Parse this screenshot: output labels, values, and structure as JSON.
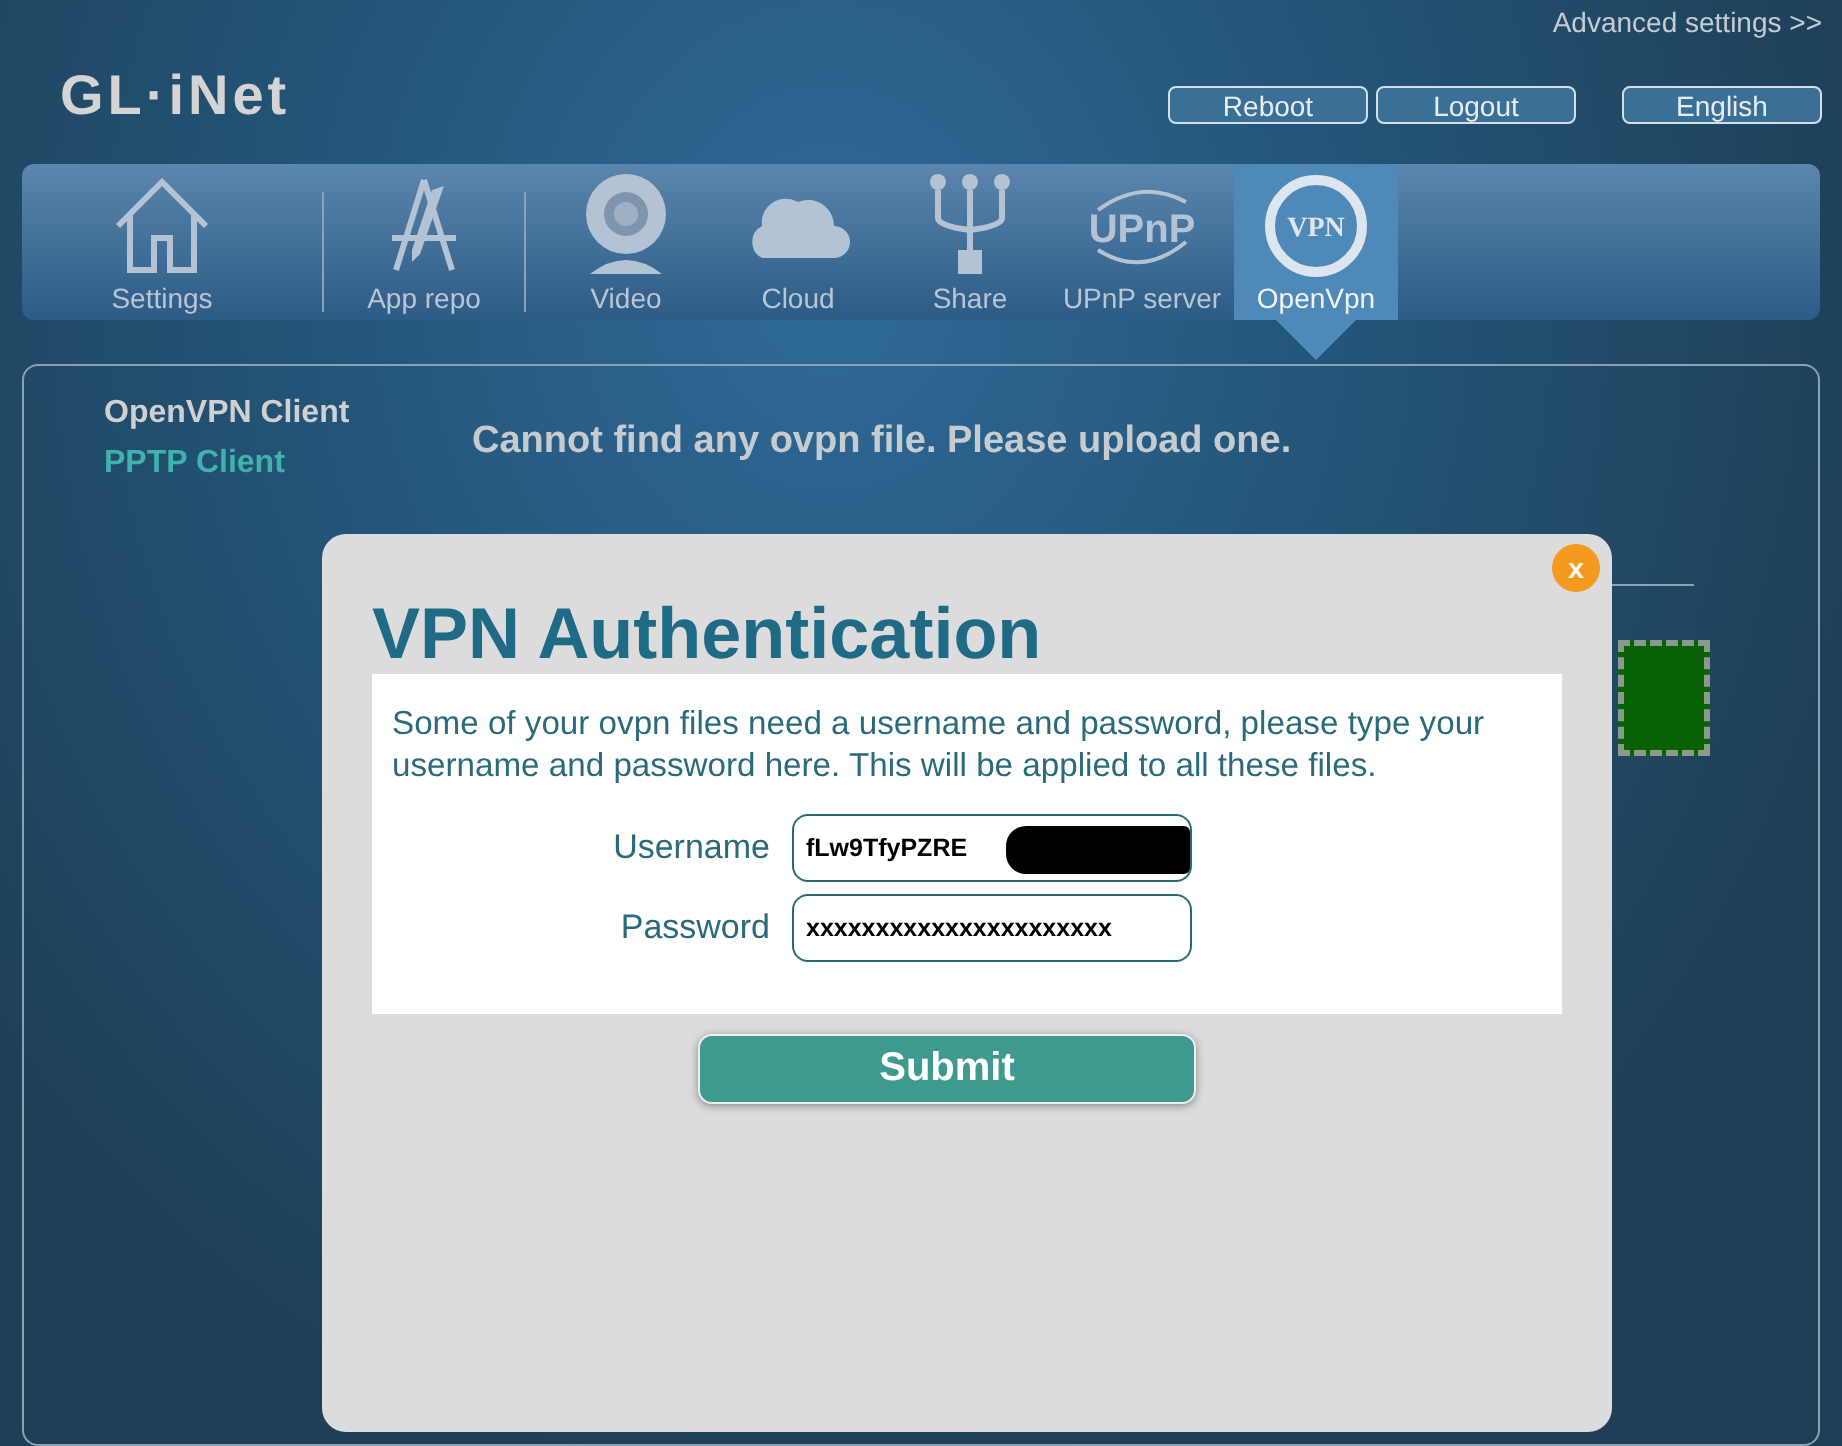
{
  "header": {
    "logo": "GL·iNet",
    "advanced_link": "Advanced settings >>",
    "buttons": [
      {
        "label": "Reboot"
      },
      {
        "label": "Logout"
      },
      {
        "label": "English"
      }
    ]
  },
  "nav": {
    "tabs": [
      {
        "label": "Settings",
        "kind": "home",
        "selected": false,
        "separator_after": true
      },
      {
        "label": "App repo",
        "kind": "apps",
        "selected": false,
        "separator_after": true
      },
      {
        "label": "Video",
        "kind": "camera",
        "selected": false,
        "separator_after": false
      },
      {
        "label": "Cloud",
        "kind": "cloud",
        "selected": false,
        "separator_after": false
      },
      {
        "label": "Share",
        "kind": "usb",
        "selected": false,
        "separator_after": false
      },
      {
        "label": "UPnP server",
        "kind": "upnp",
        "icon_text": "UPnP",
        "selected": false,
        "separator_after": false
      },
      {
        "label": "OpenVpn",
        "kind": "vpn",
        "icon_text": "VPN",
        "selected": true,
        "separator_after": false
      }
    ]
  },
  "sidebar": {
    "items": [
      {
        "label": "OpenVPN Client",
        "selected": false
      },
      {
        "label": "PPTP Client",
        "selected": true
      }
    ]
  },
  "main": {
    "heading": "Cannot find any ovpn file. Please upload one."
  },
  "dialog": {
    "close": "x",
    "title": "VPN Authentication",
    "message": "Some of your ovpn files need a username and password, please type your username and password here. This will be applied to all these files.",
    "fields": [
      {
        "label": "Username",
        "value": "fLw9TfyPZRE",
        "redacted": true
      },
      {
        "label": "Password",
        "value": "xxxxxxxxxxxxxxxxxxxxxx",
        "redacted": false
      }
    ],
    "submit": "Submit"
  }
}
